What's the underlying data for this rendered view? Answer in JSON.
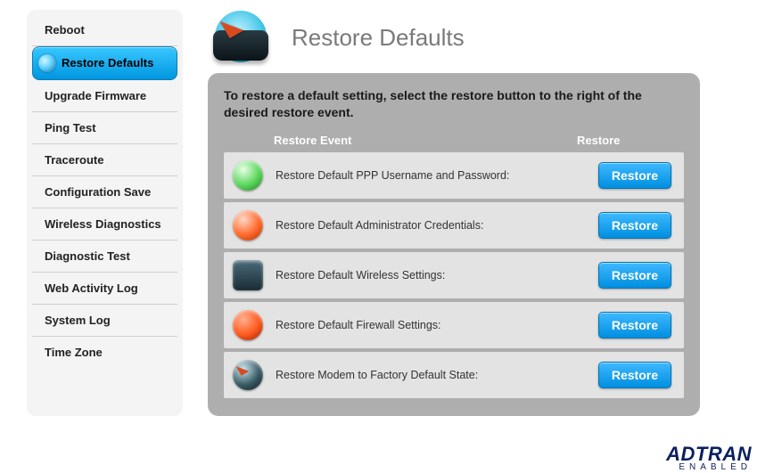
{
  "sidebar": {
    "items": [
      {
        "label": "Reboot"
      },
      {
        "label": "Restore Defaults"
      },
      {
        "label": "Upgrade Firmware"
      },
      {
        "label": "Ping Test"
      },
      {
        "label": "Traceroute"
      },
      {
        "label": "Configuration Save"
      },
      {
        "label": "Wireless Diagnostics"
      },
      {
        "label": "Diagnostic Test"
      },
      {
        "label": "Web Activity Log"
      },
      {
        "label": "System Log"
      },
      {
        "label": "Time Zone"
      }
    ],
    "active_index": 1
  },
  "header": {
    "title": "Restore Defaults"
  },
  "panel": {
    "instructions": "To restore a default setting, select the restore button to the right of the desired restore event.",
    "columns": {
      "event": "Restore Event",
      "restore": "Restore"
    },
    "button_label": "Restore",
    "rows": [
      {
        "label": "Restore Default PPP Username and Password:",
        "icon": "ppp"
      },
      {
        "label": "Restore Default Administrator Credentials:",
        "icon": "admin"
      },
      {
        "label": "Restore Default Wireless Settings:",
        "icon": "wifi"
      },
      {
        "label": "Restore Default Firewall Settings:",
        "icon": "fire"
      },
      {
        "label": "Restore Modem to Factory Default State:",
        "icon": "factory"
      }
    ]
  },
  "brand": {
    "name": "ADTRAN",
    "tag": "ENABLED"
  }
}
